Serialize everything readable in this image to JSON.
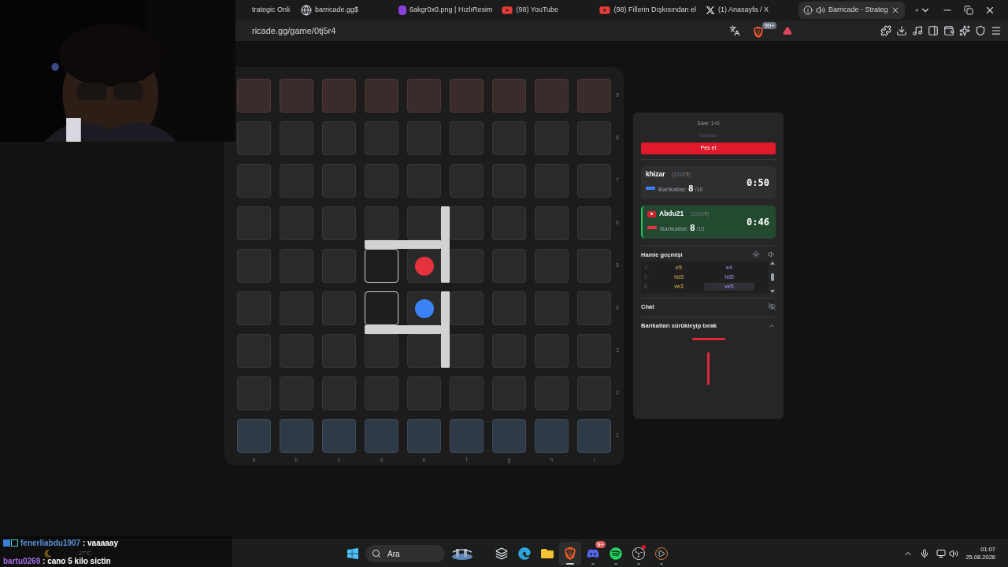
{
  "browser": {
    "tabs": [
      {
        "label": "trategic Onli",
        "kind": "none",
        "selected": false,
        "audio": false
      },
      {
        "label": "barricade.gg$",
        "kind": "globe",
        "selected": false,
        "audio": false
      },
      {
        "label": "6akgr0x0.png | HızlıResim",
        "kind": "image_host",
        "selected": false,
        "audio": false
      },
      {
        "label": "(98) YouTube",
        "kind": "video",
        "selected": false,
        "audio": false
      },
      {
        "label": "(98) Fillerin Dışkısından el",
        "kind": "video",
        "selected": false,
        "audio": false
      },
      {
        "label": "(1) Anasayfa / X",
        "kind": "x",
        "selected": false,
        "audio": false
      },
      {
        "label": "Barricade - Strateg",
        "kind": "info",
        "selected": true,
        "audio": true
      }
    ],
    "address": "ricade.gg/game/0tj5r4",
    "shield_badge": "99+"
  },
  "board": {
    "columns": [
      "a",
      "b",
      "c",
      "d",
      "e",
      "f",
      "g",
      "h",
      "i"
    ],
    "rows": [
      {
        "label": "9",
        "kind": "red_goal",
        "cells": [
          {
            "highlighted": false
          },
          {
            "highlighted": false
          },
          {
            "highlighted": false
          },
          {
            "highlighted": false
          },
          {
            "highlighted": false
          },
          {
            "highlighted": false
          },
          {
            "highlighted": false
          },
          {
            "highlighted": false
          },
          {
            "highlighted": false
          }
        ]
      },
      {
        "label": "8",
        "kind": "plain",
        "cells": [
          {
            "highlighted": false
          },
          {
            "highlighted": false
          },
          {
            "highlighted": false
          },
          {
            "highlighted": false
          },
          {
            "highlighted": false
          },
          {
            "highlighted": false
          },
          {
            "highlighted": false
          },
          {
            "highlighted": false
          },
          {
            "highlighted": false
          }
        ]
      },
      {
        "label": "7",
        "kind": "plain",
        "cells": [
          {
            "highlighted": false
          },
          {
            "highlighted": false
          },
          {
            "highlighted": false
          },
          {
            "highlighted": false
          },
          {
            "highlighted": false
          },
          {
            "highlighted": false
          },
          {
            "highlighted": false
          },
          {
            "highlighted": false
          },
          {
            "highlighted": false
          }
        ]
      },
      {
        "label": "6",
        "kind": "plain",
        "cells": [
          {
            "highlighted": false
          },
          {
            "highlighted": false
          },
          {
            "highlighted": false
          },
          {
            "highlighted": false
          },
          {
            "highlighted": false,
            "wall_right": true
          },
          {
            "highlighted": false
          },
          {
            "highlighted": false
          },
          {
            "highlighted": false
          },
          {
            "highlighted": false
          }
        ]
      },
      {
        "label": "5",
        "kind": "plain",
        "cells": [
          {
            "highlighted": false
          },
          {
            "highlighted": false
          },
          {
            "highlighted": false
          },
          {
            "highlighted": true,
            "wall_top": true
          },
          {
            "highlighted": false,
            "color": "#e5323f"
          },
          {
            "highlighted": false
          },
          {
            "highlighted": false
          },
          {
            "highlighted": false
          },
          {
            "highlighted": false
          }
        ]
      },
      {
        "label": "4",
        "kind": "plain",
        "cells": [
          {
            "highlighted": false
          },
          {
            "highlighted": false
          },
          {
            "highlighted": false
          },
          {
            "highlighted": true
          },
          {
            "highlighted": false,
            "color": "#3b82f6",
            "wall_right": true
          },
          {
            "highlighted": false
          },
          {
            "highlighted": false
          },
          {
            "highlighted": false
          },
          {
            "highlighted": false
          }
        ]
      },
      {
        "label": "3",
        "kind": "plain",
        "cells": [
          {
            "highlighted": false
          },
          {
            "highlighted": false
          },
          {
            "highlighted": false
          },
          {
            "highlighted": false,
            "wall_top": true
          },
          {
            "highlighted": false
          },
          {
            "highlighted": false
          },
          {
            "highlighted": false
          },
          {
            "highlighted": false
          },
          {
            "highlighted": false
          }
        ]
      },
      {
        "label": "2",
        "kind": "plain",
        "cells": [
          {
            "highlighted": false
          },
          {
            "highlighted": false
          },
          {
            "highlighted": false
          },
          {
            "highlighted": false
          },
          {
            "highlighted": false
          },
          {
            "highlighted": false
          },
          {
            "highlighted": false
          },
          {
            "highlighted": false
          },
          {
            "highlighted": false
          }
        ]
      },
      {
        "label": "1",
        "kind": "blue_goal",
        "cells": [
          {
            "highlighted": false
          },
          {
            "highlighted": false
          },
          {
            "highlighted": false
          },
          {
            "highlighted": false
          },
          {
            "highlighted": false
          },
          {
            "highlighted": false
          },
          {
            "highlighted": false
          },
          {
            "highlighted": false
          },
          {
            "highlighted": false
          }
        ]
      }
    ]
  },
  "panel": {
    "time_control": "Süre: 1+0",
    "mode": "Sıradan",
    "resign": "Pes et",
    "players": [
      {
        "name": "khizar",
        "rating": "(1200",
        "provisional": "?",
        "rating_end": ")",
        "flag": false,
        "label": "Barikatlar:",
        "count": "8",
        "total": "/10",
        "time": "0:50",
        "color": "#3b82f6",
        "active": false
      },
      {
        "name": "Abdu21",
        "rating": "(1200",
        "provisional": "?",
        "rating_end": ")",
        "flag": true,
        "label": "Barikatlar:",
        "count": "8",
        "total": "/10",
        "time": "0:46",
        "color": "#e5323f",
        "active": true
      }
    ],
    "history_title": "Hamle geçmişi",
    "moves": [
      {
        "number": "4.",
        "first": {
          "text": "e5",
          "selected": false
        },
        "second": {
          "text": "e4",
          "selected": false
        }
      },
      {
        "number": "5.",
        "first": {
          "text": "hd3",
          "selected": false
        },
        "second": {
          "text": "hd5",
          "selected": false
        }
      },
      {
        "number": "6.",
        "first": {
          "text": "ve3",
          "selected": false
        },
        "second": {
          "text": "ve5",
          "selected": true
        }
      }
    ],
    "chat_title": "Chat",
    "drag_title": "Barikatları sürükleyip bırak",
    "drag_expanded": true
  },
  "stream_chat": [
    {
      "user": "fenerliabdu1907",
      "message": ": vaaaaay",
      "color": "#5b8fd6",
      "badges": true
    },
    {
      "user": "bartu0269",
      "message": ": cano 5 kilo sictin",
      "color": "#a56ee8",
      "badges": false
    }
  ],
  "taskbar": {
    "weather": "27°C",
    "search": "Ara",
    "apps": [
      {
        "kind": "task_view",
        "active": false,
        "running": false
      },
      {
        "kind": "edge",
        "active": false,
        "running": false
      },
      {
        "kind": "folder",
        "active": false,
        "running": false
      },
      {
        "kind": "brave",
        "active": true,
        "running": true
      },
      {
        "kind": "discord",
        "active": false,
        "running": true,
        "badge": "9+"
      },
      {
        "kind": "spotify",
        "active": false,
        "running": true
      },
      {
        "kind": "obs",
        "active": false,
        "running": true,
        "alert": true
      },
      {
        "kind": "player",
        "active": false,
        "running": true
      }
    ],
    "time": "01:07",
    "date": "25.08.2026"
  }
}
